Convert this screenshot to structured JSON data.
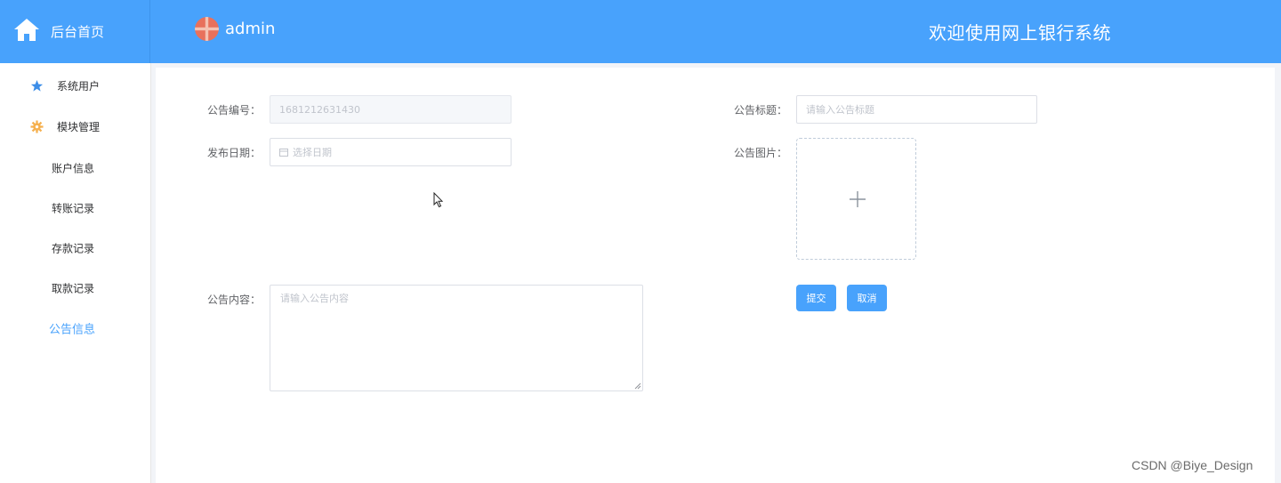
{
  "header": {
    "brand_label": "后台首页",
    "username": "admin",
    "site_title": "欢迎使用网上银行系统"
  },
  "sidebar": {
    "items": [
      {
        "label": "系统用户",
        "icon": "star-icon"
      },
      {
        "label": "模块管理",
        "icon": "gear-icon"
      }
    ],
    "sub_items": [
      {
        "label": "账户信息"
      },
      {
        "label": "转账记录"
      },
      {
        "label": "存款记录"
      },
      {
        "label": "取款记录"
      },
      {
        "label": "公告信息",
        "active": true
      }
    ]
  },
  "form": {
    "id_label": "公告编号：",
    "id_value": "1681212631430",
    "title_label": "公告标题：",
    "title_placeholder": "请输入公告标题",
    "date_label": "发布日期：",
    "date_placeholder": "选择日期",
    "image_label": "公告图片：",
    "content_label": "公告内容：",
    "content_placeholder": "请输入公告内容",
    "submit_label": "提交",
    "cancel_label": "取消"
  },
  "colors": {
    "primary": "#48a2fc",
    "active_text": "#48a2fc"
  },
  "watermark": "CSDN @Biye_Design"
}
